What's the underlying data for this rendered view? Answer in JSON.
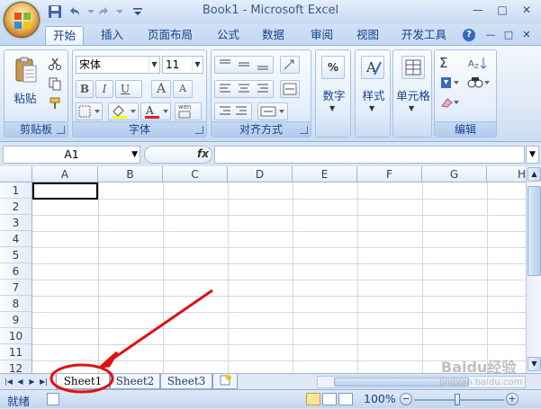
{
  "window": {
    "title": "Book1 - Microsoft Excel",
    "controls": [
      "—",
      "□",
      "✕"
    ]
  },
  "tabs": [
    {
      "label": "开始",
      "active": true
    },
    {
      "label": "插入"
    },
    {
      "label": "页面布局"
    },
    {
      "label": "公式"
    },
    {
      "label": "数据"
    },
    {
      "label": "审阅"
    },
    {
      "label": "视图"
    },
    {
      "label": "开发工具"
    }
  ],
  "ribbon_controls": [
    "?",
    "—",
    "□",
    "✕"
  ],
  "ribbon": {
    "clipboard": {
      "label": "剪贴板",
      "paste": "粘贴"
    },
    "font": {
      "label": "字体",
      "font_name": "宋体",
      "font_size": "11",
      "bold": "B",
      "italic": "I",
      "underline": "U",
      "grow": "A",
      "shrink": "A",
      "font_color_glyph": "A",
      "pinyin": "wén"
    },
    "alignment": {
      "label": "对齐方式"
    },
    "number": {
      "label": "数字",
      "percent": "%"
    },
    "styles": {
      "label": "样式"
    },
    "cells": {
      "label": "单元格"
    },
    "editing": {
      "label": "编辑",
      "sum": "Σ"
    }
  },
  "formula_bar": {
    "name_box": "A1",
    "fx": "fx",
    "value": ""
  },
  "columns": [
    "A",
    "B",
    "C",
    "D",
    "E",
    "F",
    "G",
    "H"
  ],
  "rows": [
    "1",
    "2",
    "3",
    "4",
    "5",
    "6",
    "7",
    "8",
    "9",
    "10",
    "11",
    "12"
  ],
  "sheets": [
    {
      "name": "Sheet1",
      "active": true
    },
    {
      "name": "Sheet2"
    },
    {
      "name": "Sheet3"
    }
  ],
  "status": {
    "text": "就绪",
    "zoom": "100%",
    "zoom_out": "−",
    "zoom_in": "+"
  },
  "watermark": {
    "text": "Baidu经验",
    "sub": "jingyan.baidu.com"
  },
  "colors": {
    "annotation": "#e01010",
    "accent": "#15428b"
  }
}
